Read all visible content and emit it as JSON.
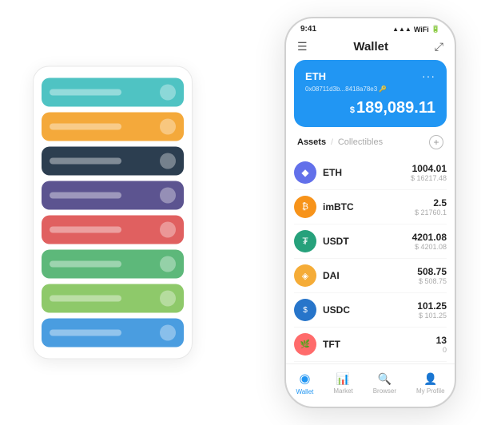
{
  "scene": {
    "background": "#ffffff"
  },
  "card_stack": {
    "cards": [
      {
        "color": "card-teal",
        "id": "teal"
      },
      {
        "color": "card-orange",
        "id": "orange"
      },
      {
        "color": "card-dark",
        "id": "dark"
      },
      {
        "color": "card-purple",
        "id": "purple"
      },
      {
        "color": "card-red",
        "id": "red"
      },
      {
        "color": "card-green",
        "id": "green"
      },
      {
        "color": "card-lightgreen",
        "id": "lightgreen"
      },
      {
        "color": "card-blue",
        "id": "blue"
      }
    ]
  },
  "phone": {
    "status_bar": {
      "time": "9:41",
      "signal": "●●●",
      "wifi": "WiFi",
      "battery": "▮"
    },
    "header": {
      "menu_icon": "☰",
      "title": "Wallet",
      "expand_icon": "⤢"
    },
    "eth_card": {
      "title": "ETH",
      "dots": "···",
      "address": "0x08711d3b...8418a78e3 🔑",
      "dollar_sign": "$",
      "amount": "189,089.11"
    },
    "assets": {
      "tab_active": "Assets",
      "tab_divider": "/",
      "tab_inactive": "Collectibles",
      "add_icon": "+"
    },
    "asset_list": [
      {
        "icon": "◆",
        "icon_class": "coin-eth",
        "name": "ETH",
        "amount": "1004.01",
        "usd": "$ 16217.48"
      },
      {
        "icon": "₿",
        "icon_class": "coin-imbtc",
        "name": "imBTC",
        "amount": "2.5",
        "usd": "$ 21760.1"
      },
      {
        "icon": "₮",
        "icon_class": "coin-usdt",
        "name": "USDT",
        "amount": "4201.08",
        "usd": "$ 4201.08"
      },
      {
        "icon": "◈",
        "icon_class": "coin-dai",
        "name": "DAI",
        "amount": "508.75",
        "usd": "$ 508.75"
      },
      {
        "icon": "$",
        "icon_class": "coin-usdc",
        "name": "USDC",
        "amount": "101.25",
        "usd": "$ 101.25"
      },
      {
        "icon": "🌿",
        "icon_class": "coin-tft",
        "name": "TFT",
        "amount": "13",
        "usd": "0"
      }
    ],
    "bottom_nav": [
      {
        "icon": "◉",
        "label": "Wallet",
        "active": true
      },
      {
        "icon": "📈",
        "label": "Market",
        "active": false
      },
      {
        "icon": "🔍",
        "label": "Browser",
        "active": false
      },
      {
        "icon": "👤",
        "label": "My Profile",
        "active": false
      }
    ]
  }
}
